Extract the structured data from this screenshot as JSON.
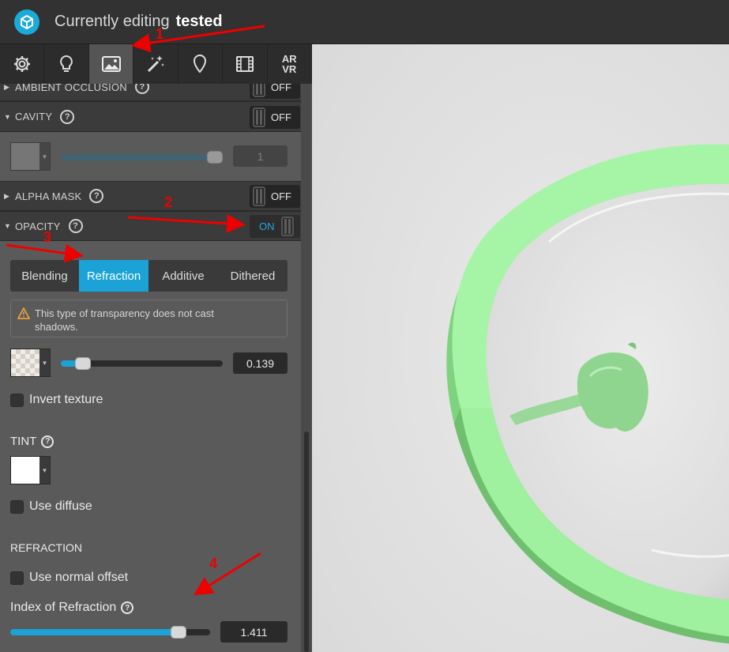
{
  "header": {
    "editing_label": "Currently editing",
    "project_name": "tested"
  },
  "toolbar": {
    "items": [
      {
        "name": "settings",
        "icon": "gear-icon"
      },
      {
        "name": "lighting",
        "icon": "lightbulb-icon"
      },
      {
        "name": "materials",
        "icon": "image-icon",
        "active": true
      },
      {
        "name": "post-processing",
        "icon": "magic-wand-icon"
      },
      {
        "name": "annotations",
        "icon": "map-pin-icon"
      },
      {
        "name": "animation",
        "icon": "film-icon"
      },
      {
        "name": "ar-vr",
        "icon": "ar-vr-text",
        "label_top": "AR",
        "label_bottom": "VR"
      }
    ]
  },
  "panel": {
    "ambient_occlusion": {
      "label": "AMBIENT OCCLUSION",
      "toggle": "OFF"
    },
    "cavity": {
      "label": "CAVITY",
      "toggle": "OFF",
      "value": "1",
      "slider_fraction": 0.97,
      "swatch_color": "#8a8a8a"
    },
    "alpha_mask": {
      "label": "ALPHA MASK",
      "toggle": "OFF"
    },
    "opacity": {
      "label": "OPACITY",
      "toggle": "ON",
      "modes": [
        "Blending",
        "Refraction",
        "Additive",
        "Dithered"
      ],
      "active_mode": "Refraction",
      "warning_line1": "This type of transparency does not cast",
      "warning_line2": "shadows.",
      "value": "0.139",
      "slider_fraction": 0.139,
      "invert_texture_label": "Invert texture"
    },
    "tint": {
      "label": "TINT",
      "swatch_color": "#ffffff",
      "use_diffuse_label": "Use diffuse"
    },
    "refraction": {
      "heading": "REFRACTION",
      "use_normal_offset_label": "Use normal offset",
      "ior_label": "Index of Refraction",
      "ior_value": "1.411",
      "slider_fraction": 0.84
    }
  },
  "annotations": [
    "1",
    "2",
    "3",
    "4"
  ],
  "colors": {
    "accent": "#1ba3d8",
    "model_green": "#8fe88f",
    "annotation_red": "#e00000"
  }
}
